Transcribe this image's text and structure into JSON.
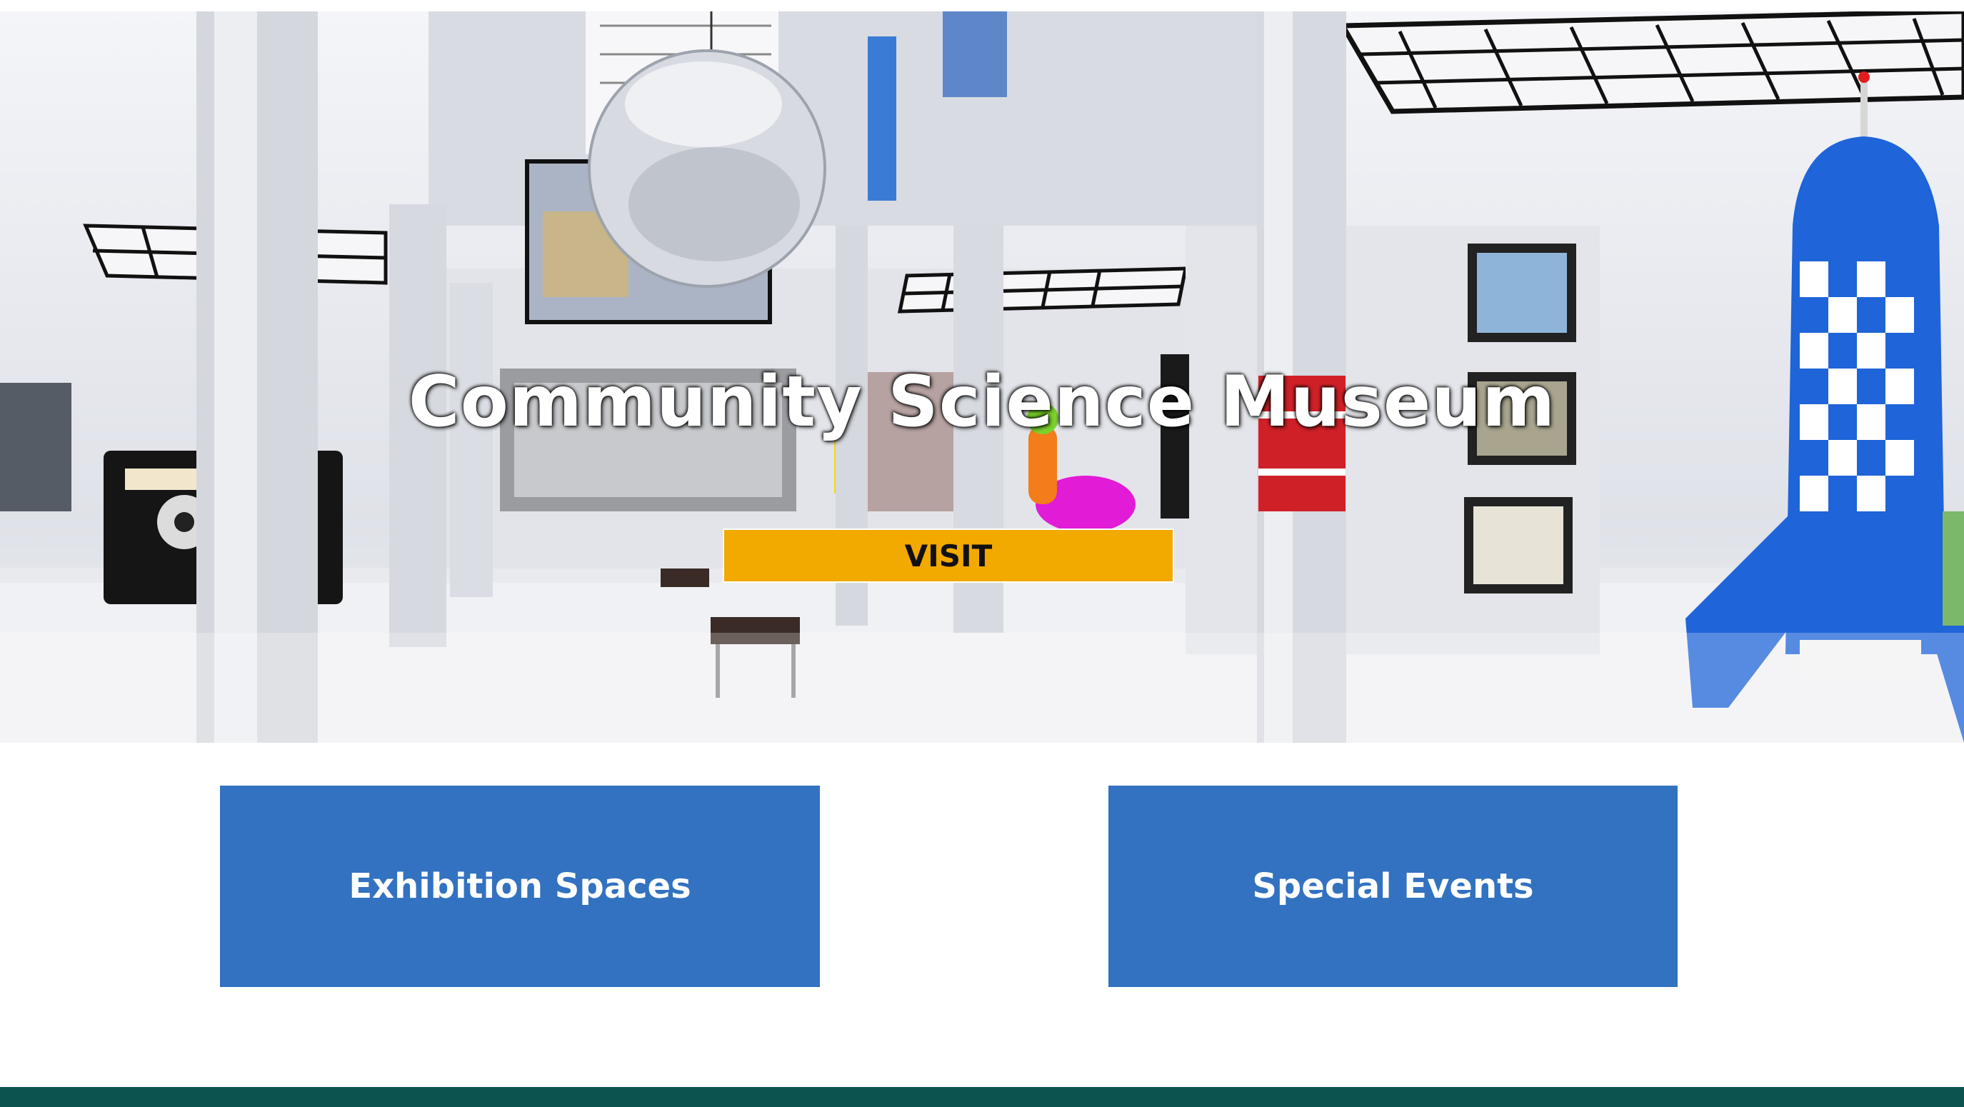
{
  "hero": {
    "title": "Community Science Museum",
    "visit_label": "VISIT",
    "image_description_icon": "museum-hall-image"
  },
  "cards": {
    "exhibitions_label": "Exhibition Spaces",
    "events_label": "Special Events"
  },
  "colors": {
    "visit_button": "#f2a900",
    "card_blue": "#3272c0",
    "footer": "#0c5350"
  }
}
